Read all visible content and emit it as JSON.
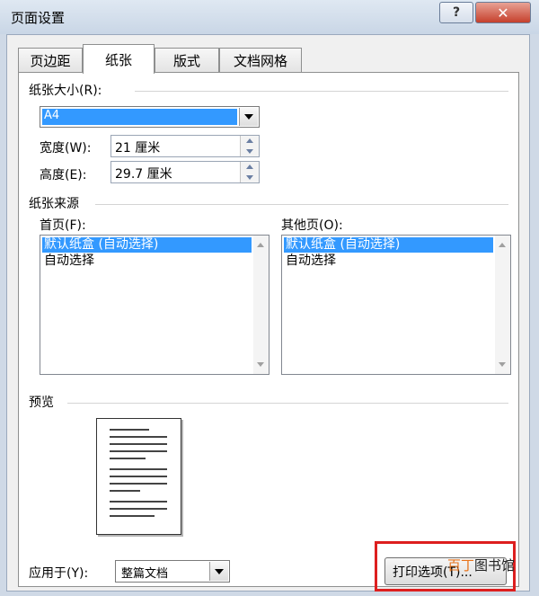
{
  "window": {
    "title": "页面设置",
    "help_label": "?",
    "close_label": "✕"
  },
  "tabs": [
    {
      "label": "页边距"
    },
    {
      "label": "纸张",
      "active": true
    },
    {
      "label": "版式"
    },
    {
      "label": "文档网格"
    }
  ],
  "paper_size": {
    "section_label": "纸张大小(R):",
    "selected": "A4",
    "width_label": "宽度(W):",
    "width_value": "21 厘米",
    "height_label": "高度(E):",
    "height_value": "29.7 厘米"
  },
  "paper_source": {
    "section_label": "纸张来源",
    "first_page_label": "首页(F):",
    "first_page_items": [
      "默认纸盒 (自动选择)",
      "自动选择"
    ],
    "other_pages_label": "其他页(O):",
    "other_pages_items": [
      "默认纸盒 (自动选择)",
      "自动选择"
    ]
  },
  "preview": {
    "section_label": "预览"
  },
  "apply_to": {
    "label": "应用于(Y):",
    "value": "整篇文档"
  },
  "print_options_button": "打印选项(T)...",
  "watermark": {
    "part1": "百丁",
    "part2": "图书馆"
  },
  "colors": {
    "selection": "#3399ff",
    "highlight_box": "#dd1f1f"
  }
}
